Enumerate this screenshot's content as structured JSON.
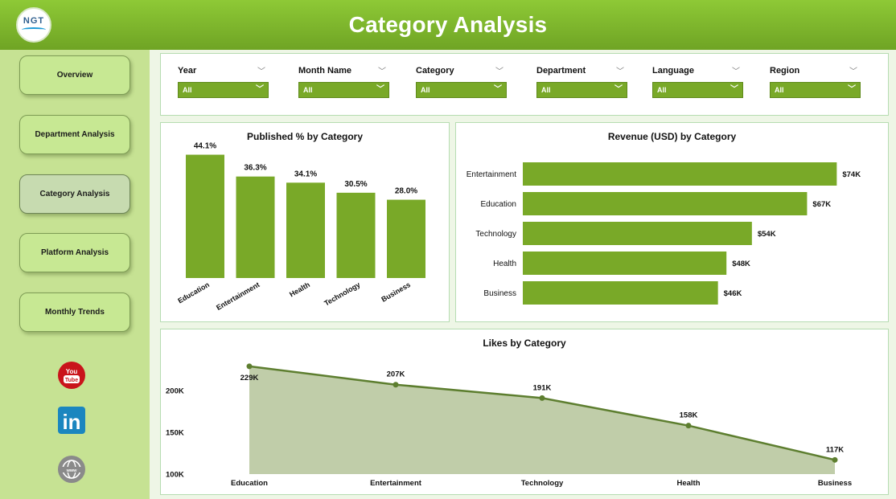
{
  "header": {
    "title": "Category Analysis",
    "logo_text": "NGT"
  },
  "sidebar": {
    "items": [
      {
        "label": "Overview"
      },
      {
        "label": "Department Analysis"
      },
      {
        "label": "Category Analysis",
        "active": true
      },
      {
        "label": "Platform Analysis"
      },
      {
        "label": "Monthly Trends"
      }
    ],
    "social": [
      "youtube-icon",
      "linkedin-icon",
      "website-globe-icon"
    ],
    "youtube_text": "You Tube",
    "linkedin_text": "in"
  },
  "filters": [
    {
      "label": "Year",
      "value": "All"
    },
    {
      "label": "Month Name",
      "value": "All"
    },
    {
      "label": "Category",
      "value": "All"
    },
    {
      "label": "Department",
      "value": "All"
    },
    {
      "label": "Language",
      "value": "All"
    },
    {
      "label": "Region",
      "value": "All"
    }
  ],
  "colors": {
    "accent": "#79a928",
    "line": "#5d7e2f",
    "area": "#c0cda9",
    "header": "#7fb52d",
    "sidebar": "#c6e293"
  },
  "chart_data": [
    {
      "type": "bar",
      "title": "Published % by Category",
      "categories": [
        "Education",
        "Entertainment",
        "Health",
        "Technology",
        "Business"
      ],
      "values": [
        44.1,
        36.3,
        34.1,
        30.5,
        28.0
      ],
      "data_labels": [
        "44.1%",
        "36.3%",
        "34.1%",
        "30.5%",
        "28.0%"
      ],
      "ylim": [
        0,
        50
      ]
    },
    {
      "type": "bar",
      "orientation": "horizontal",
      "title": "Revenue (USD) by Category",
      "categories": [
        "Entertainment",
        "Education",
        "Technology",
        "Health",
        "Business"
      ],
      "values": [
        74,
        67,
        54,
        48,
        46
      ],
      "data_labels": [
        "$74K",
        "$67K",
        "$54K",
        "$48K",
        "$46K"
      ],
      "xlim": [
        0,
        80
      ]
    },
    {
      "type": "area",
      "title": "Likes by Category",
      "categories": [
        "Education",
        "Entertainment",
        "Technology",
        "Health",
        "Business"
      ],
      "values": [
        229000,
        207000,
        191000,
        158000,
        117000
      ],
      "data_labels": [
        "229K",
        "207K",
        "191K",
        "158K",
        "117K"
      ],
      "yticks": [
        "100K",
        "150K",
        "200K"
      ],
      "ylim": [
        100000,
        240000
      ]
    }
  ]
}
